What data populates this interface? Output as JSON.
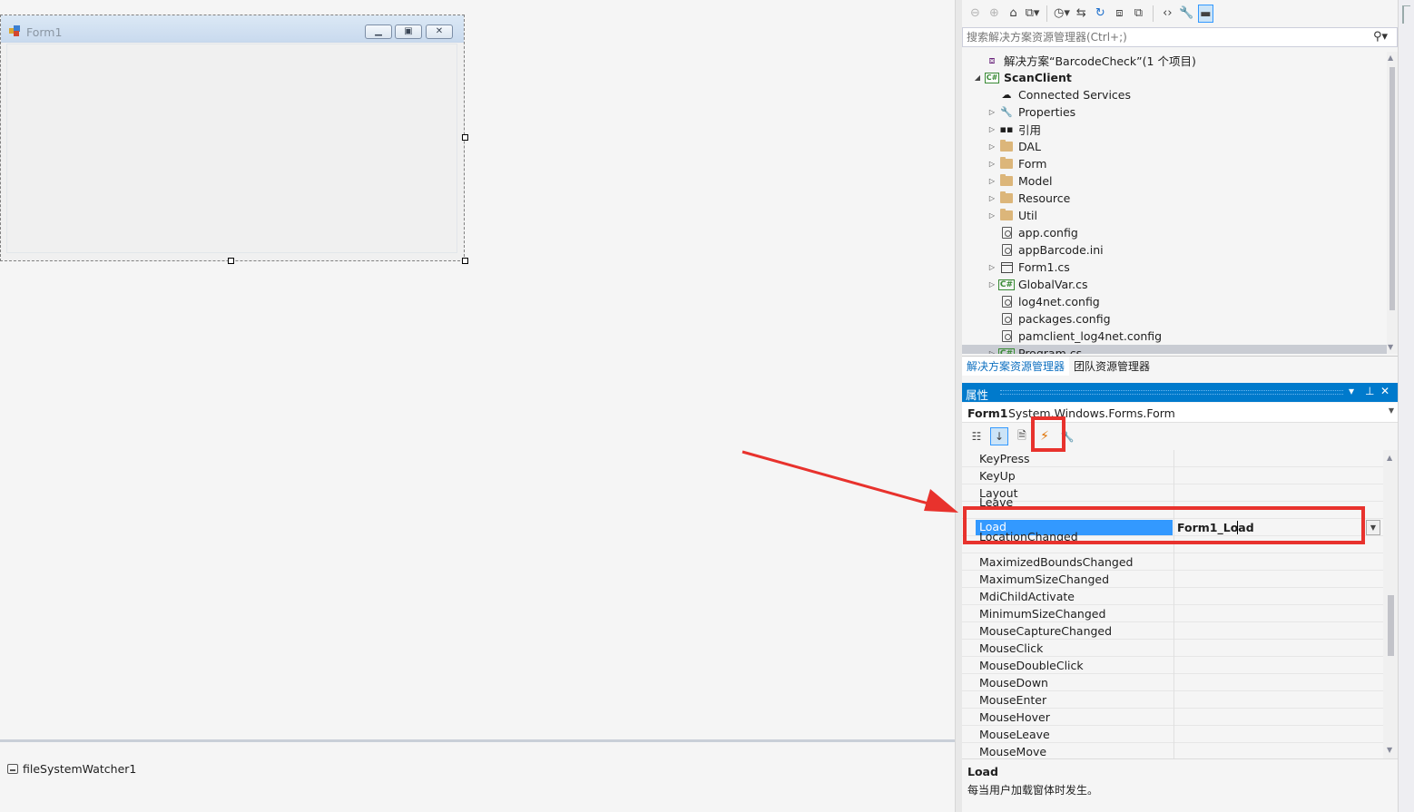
{
  "designer": {
    "form_title": "Form1",
    "tray_component": "fileSystemWatcher1"
  },
  "solution_explorer": {
    "search_placeholder": "搜索解决方案资源管理器(Ctrl+;)",
    "tree": [
      {
        "label": "解决方案“BarcodeCheck”(1 个项目)",
        "icon": "solution-icon",
        "level": 0,
        "expander": "none",
        "bold": false
      },
      {
        "label": "ScanClient",
        "icon": "csharp-project-icon",
        "level": 0,
        "expander": "expanded",
        "bold": true
      },
      {
        "label": "Connected Services",
        "icon": "connected-services-icon",
        "level": 1,
        "expander": "none",
        "bold": false
      },
      {
        "label": "Properties",
        "icon": "wrench-icon",
        "level": 1,
        "expander": "collapsed",
        "bold": false
      },
      {
        "label": "引用",
        "icon": "references-icon",
        "level": 1,
        "expander": "collapsed",
        "bold": false
      },
      {
        "label": "DAL",
        "icon": "folder-icon",
        "level": 1,
        "expander": "collapsed",
        "bold": false
      },
      {
        "label": "Form",
        "icon": "folder-icon",
        "level": 1,
        "expander": "collapsed",
        "bold": false
      },
      {
        "label": "Model",
        "icon": "folder-icon",
        "level": 1,
        "expander": "collapsed",
        "bold": false
      },
      {
        "label": "Resource",
        "icon": "folder-icon",
        "level": 1,
        "expander": "collapsed",
        "bold": false
      },
      {
        "label": "Util",
        "icon": "folder-icon",
        "level": 1,
        "expander": "collapsed",
        "bold": false
      },
      {
        "label": "app.config",
        "icon": "config-file-icon",
        "level": 1,
        "expander": "none",
        "bold": false
      },
      {
        "label": "appBarcode.ini",
        "icon": "config-file-icon",
        "level": 1,
        "expander": "none",
        "bold": false
      },
      {
        "label": "Form1.cs",
        "icon": "form-file-icon",
        "level": 1,
        "expander": "collapsed",
        "bold": false
      },
      {
        "label": "GlobalVar.cs",
        "icon": "csharp-file-icon",
        "level": 1,
        "expander": "collapsed",
        "bold": false
      },
      {
        "label": "log4net.config",
        "icon": "config-file-icon",
        "level": 1,
        "expander": "none",
        "bold": false
      },
      {
        "label": "packages.config",
        "icon": "config-file-icon",
        "level": 1,
        "expander": "none",
        "bold": false
      },
      {
        "label": "pamclient_log4net.config",
        "icon": "config-file-icon",
        "level": 1,
        "expander": "none",
        "bold": false
      },
      {
        "label": "Program.cs",
        "icon": "csharp-file-icon",
        "level": 1,
        "expander": "collapsed",
        "bold": false,
        "selected": true
      }
    ],
    "tabs": [
      "解决方案资源管理器",
      "团队资源管理器"
    ]
  },
  "properties": {
    "title": "属性",
    "object_name": "Form1",
    "object_type": "System.Windows.Forms.Form",
    "events": [
      {
        "name": "KeyPress",
        "value": ""
      },
      {
        "name": "KeyUp",
        "value": ""
      },
      {
        "name": "Layout",
        "value": ""
      },
      {
        "name": "Leave",
        "value": "",
        "partial": true
      },
      {
        "name": "Load",
        "value": "Form1_Load",
        "selected": true
      },
      {
        "name": "LocationChanged",
        "value": "",
        "partial": true
      },
      {
        "name": "MaximizedBoundsChanged",
        "value": ""
      },
      {
        "name": "MaximumSizeChanged",
        "value": ""
      },
      {
        "name": "MdiChildActivate",
        "value": ""
      },
      {
        "name": "MinimumSizeChanged",
        "value": ""
      },
      {
        "name": "MouseCaptureChanged",
        "value": ""
      },
      {
        "name": "MouseClick",
        "value": ""
      },
      {
        "name": "MouseDoubleClick",
        "value": ""
      },
      {
        "name": "MouseDown",
        "value": ""
      },
      {
        "name": "MouseEnter",
        "value": ""
      },
      {
        "name": "MouseHover",
        "value": ""
      },
      {
        "name": "MouseLeave",
        "value": ""
      },
      {
        "name": "MouseMove",
        "value": ""
      }
    ],
    "description_name": "Load",
    "description_text": "每当用户加载窗体时发生。"
  },
  "colors": {
    "accent": "#007acc",
    "selection": "#3399ff",
    "annotation_red": "#e8322d"
  }
}
